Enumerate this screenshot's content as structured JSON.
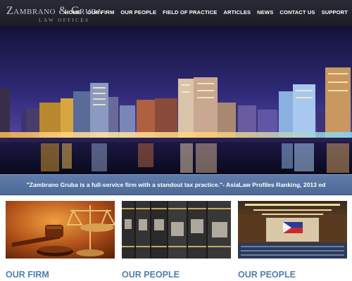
{
  "header": {
    "logo": {
      "name": "Zambrano & Gruba",
      "subtitle": "Law Offices"
    },
    "nav": [
      {
        "label": "HOME"
      },
      {
        "label": "OUR FIRM"
      },
      {
        "label": "OUR PEOPLE"
      },
      {
        "label": "FIELD OF PRACTICE"
      },
      {
        "label": "ARTICLES"
      },
      {
        "label": "NEWS"
      },
      {
        "label": "CONTACT US"
      },
      {
        "label": "SUPPORT"
      }
    ]
  },
  "hero": {
    "scene": "city-skyline-night"
  },
  "quote": {
    "text": "\"Zambrano Gruba is a full-service firm with a standout tax practice.\"- AsiaLaw Profiles Ranking, 2013 ed"
  },
  "features": [
    {
      "title": "OUR FIRM",
      "image": "gavel-image"
    },
    {
      "title": "OUR PEOPLE",
      "image": "law-books-image"
    },
    {
      "title": "OUR PEOPLE",
      "image": "legislative-hall-image"
    }
  ],
  "colors": {
    "header_bg": "#1f1f2a",
    "quote_band": "#5674a2",
    "card_title": "#4f7fae"
  }
}
